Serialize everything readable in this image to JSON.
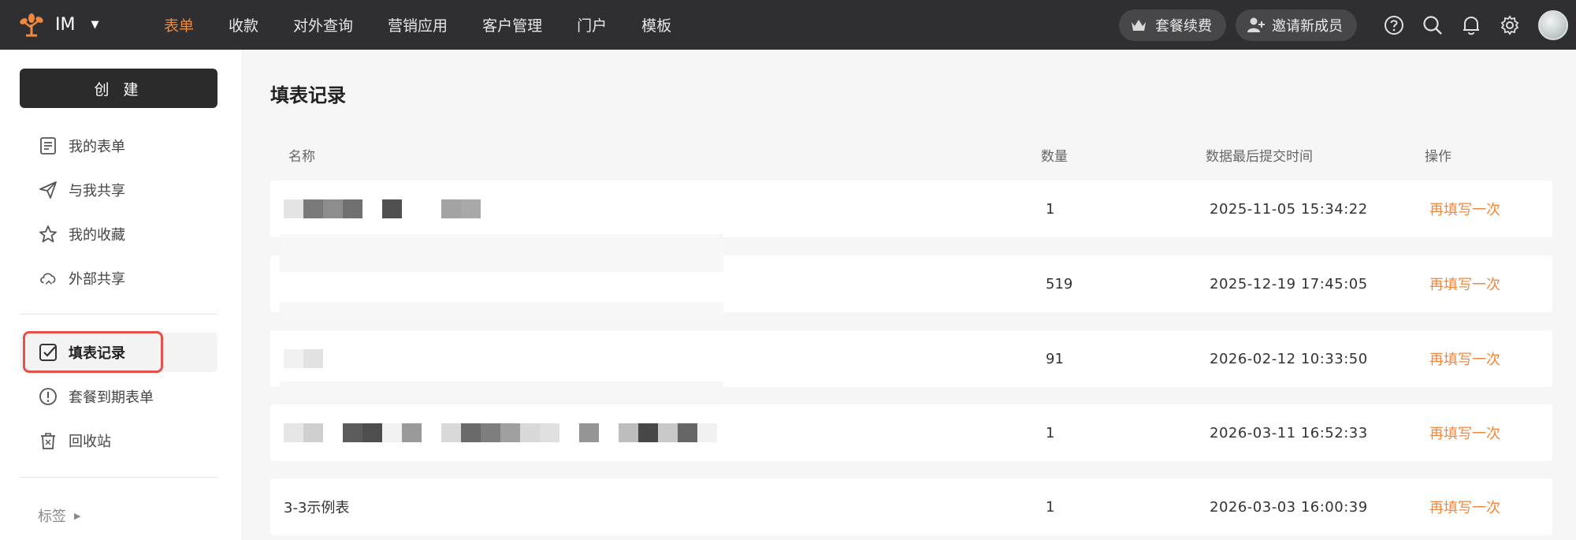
{
  "app": {
    "name": "IM",
    "accent": "#f0883e",
    "nav": [
      {
        "label": "表单",
        "active": true
      },
      {
        "label": "收款",
        "active": false
      },
      {
        "label": "对外查询",
        "active": false
      },
      {
        "label": "营销应用",
        "active": false
      },
      {
        "label": "客户管理",
        "active": false
      },
      {
        "label": "门户",
        "active": false
      },
      {
        "label": "模板",
        "active": false
      }
    ],
    "renew_label": "套餐续费",
    "invite_label": "邀请新成员",
    "icons": [
      "crown-icon",
      "add-user-icon",
      "help-icon",
      "search-icon",
      "bell-icon",
      "gear-icon"
    ]
  },
  "sidebar": {
    "create_label": "创 建",
    "items": [
      {
        "label": "我的表单",
        "icon": "document-icon"
      },
      {
        "label": "与我共享",
        "icon": "send-icon"
      },
      {
        "label": "我的收藏",
        "icon": "star-icon"
      },
      {
        "label": "外部共享",
        "icon": "cloud-share-icon"
      },
      {
        "label": "填表记录",
        "icon": "checkbox-icon",
        "active": true
      },
      {
        "label": "套餐到期表单",
        "icon": "alert-icon"
      },
      {
        "label": "回收站",
        "icon": "trash-icon"
      }
    ],
    "tags_label": "标签"
  },
  "main": {
    "title": "填表记录",
    "columns": {
      "name": "名称",
      "count": "数量",
      "time": "数据最后提交时间",
      "action": "操作"
    },
    "rows": [
      {
        "name": "",
        "count": "1",
        "time": "2025-11-05 15:34:22",
        "action": "再填写一次"
      },
      {
        "name": "",
        "count": "519",
        "time": "2025-12-19 17:45:05",
        "action": "再填写一次"
      },
      {
        "name": "",
        "count": "91",
        "time": "2026-02-12 10:33:50",
        "action": "再填写一次"
      },
      {
        "name": "",
        "count": "1",
        "time": "2026-03-11 16:52:33",
        "action": "再填写一次"
      },
      {
        "name": "3-3示例表",
        "count": "1",
        "time": "2026-03-03 16:00:39",
        "action": "再填写一次"
      }
    ]
  }
}
